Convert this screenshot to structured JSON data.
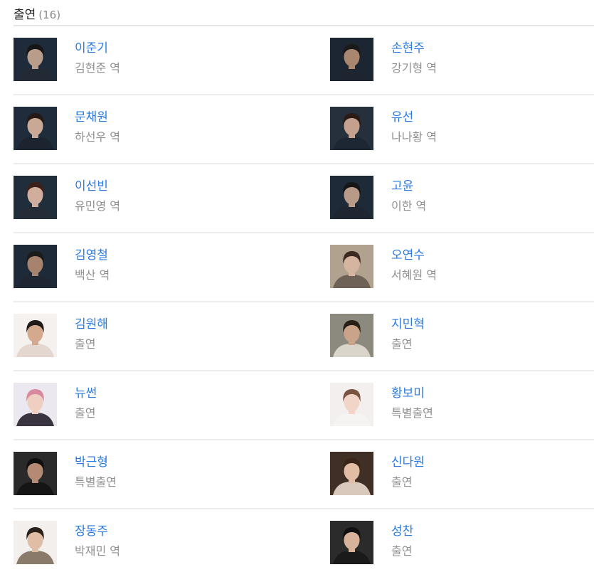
{
  "header": {
    "title": "출연",
    "count": "(16)"
  },
  "cast": [
    {
      "name": "이준기",
      "role": "김현준 역",
      "bg": "#1e2b3a",
      "face": "#b89d8a",
      "hair": "#161616",
      "shirt": "#222a36"
    },
    {
      "name": "손현주",
      "role": "강기형 역",
      "bg": "#1c2633",
      "face": "#a98670",
      "hair": "#1a1a1a",
      "shirt": "#1d2530"
    },
    {
      "name": "문채원",
      "role": "하선우 역",
      "bg": "#1f2c3b",
      "face": "#c9a895",
      "hair": "#241a16",
      "shirt": "#1c2430"
    },
    {
      "name": "유선",
      "role": "나나황 역",
      "bg": "#26303c",
      "face": "#c4a08e",
      "hair": "#2a1b16",
      "shirt": "#1d2733"
    },
    {
      "name": "이선빈",
      "role": "유민영 역",
      "bg": "#202d3b",
      "face": "#d0ad9c",
      "hair": "#3a221b",
      "shirt": "#242c38"
    },
    {
      "name": "고윤",
      "role": "이한 역",
      "bg": "#1d2a38",
      "face": "#b89a88",
      "hair": "#171717",
      "shirt": "#1e2631"
    },
    {
      "name": "김영철",
      "role": "백산 역",
      "bg": "#1e2a38",
      "face": "#a7836e",
      "hair": "#1b1b1b",
      "shirt": "#1f2733"
    },
    {
      "name": "오연수",
      "role": "서혜원 역",
      "bg": "#b0a28f",
      "face": "#d5b4a0",
      "hair": "#3a2a20",
      "shirt": "#6e6256"
    },
    {
      "name": "김원해",
      "role": "출연",
      "bg": "#f4f1ee",
      "face": "#d5a98d",
      "hair": "#1e1b18",
      "shirt": "#e3d7cf"
    },
    {
      "name": "지민혁",
      "role": "출연",
      "bg": "#8c8a7e",
      "face": "#caa48a",
      "hair": "#2a1f18",
      "shirt": "#d9d5cb"
    },
    {
      "name": "뉴썬",
      "role": "출연",
      "bg": "#ece8ef",
      "face": "#efcfc2",
      "hair": "#d98a9f",
      "shirt": "#3a3440"
    },
    {
      "name": "황보미",
      "role": "특별출연",
      "bg": "#f3efef",
      "face": "#f1d5c9",
      "hair": "#7a5240",
      "shirt": "#f6f3f3"
    },
    {
      "name": "박근형",
      "role": "특별출연",
      "bg": "#2a2a2a",
      "face": "#b58a74",
      "hair": "#0f0f0f",
      "shirt": "#151515"
    },
    {
      "name": "신다원",
      "role": "출연",
      "bg": "#3f2f25",
      "face": "#e2bda6",
      "hair": "#3a2418",
      "shirt": "#d9c9bd"
    },
    {
      "name": "장동주",
      "role": "박재민 역",
      "bg": "#f2efec",
      "face": "#e0bea6",
      "hair": "#2a211b",
      "shirt": "#8a7a6a"
    },
    {
      "name": "성찬",
      "role": "출연",
      "bg": "#2b2b2b",
      "face": "#d8b39b",
      "hair": "#111111",
      "shirt": "#1a1a1a"
    }
  ]
}
